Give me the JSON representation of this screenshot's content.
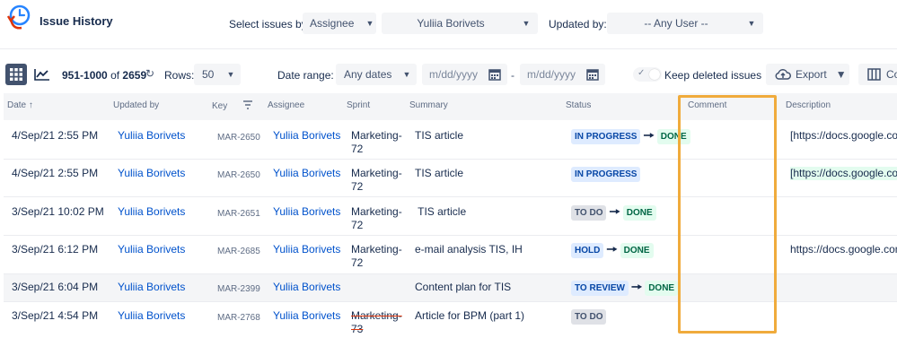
{
  "app": {
    "title": "Issue History"
  },
  "filters": {
    "select_by_label": "Select issues by:",
    "select_by_value": "Assignee",
    "assignee_value": "Yuliia Borivets",
    "updated_by_label": "Updated by:",
    "updated_by_value": "-- Any User --"
  },
  "toolbar": {
    "range_bold": "951-1000",
    "range_of": "of",
    "total": "2659",
    "rows_label": "Rows:",
    "rows_value": "50",
    "date_range_label": "Date range:",
    "date_range_value": "Any dates",
    "date_from_placeholder": "m/dd/yyyy",
    "date_to_placeholder": "m/dd/yyyy",
    "date_sep": "-",
    "keep_deleted_label": "Keep deleted issues",
    "export_label": "Export",
    "columns_label": "Co"
  },
  "columns": [
    "Date",
    "Updated by",
    "Key",
    "Assignee",
    "Sprint",
    "Summary",
    "Status",
    "Comment",
    "Description"
  ],
  "rows": [
    {
      "date": "4/Sep/21 2:55 PM",
      "updated_by": "Yuliia Borivets",
      "key": "MAR-2650",
      "assignee": "Yuliia Borivets",
      "sprint1": "Marketing-",
      "sprint2": "72",
      "summary": "TIS article",
      "status_from": "IN PROGRESS",
      "status_to": "DONE",
      "description": "[https://docs.google.com"
    },
    {
      "date": "4/Sep/21 2:55 PM",
      "updated_by": "Yuliia Borivets",
      "key": "MAR-2650",
      "assignee": "Yuliia Borivets",
      "sprint1": "Marketing-",
      "sprint2": "72",
      "summary": "TIS article",
      "status_from": "IN PROGRESS",
      "status_to": "",
      "description": "[https://docs.google.com"
    },
    {
      "date": "3/Sep/21 10:02 PM",
      "updated_by": "Yuliia Borivets",
      "key": "MAR-2651",
      "assignee": "Yuliia Borivets",
      "sprint1": "Marketing-",
      "sprint2": "72",
      "summary": " TIS article",
      "status_from": "TO DO",
      "status_to": "DONE",
      "description": ""
    },
    {
      "date": "3/Sep/21 6:12 PM",
      "updated_by": "Yuliia Borivets",
      "key": "MAR-2685",
      "assignee": "Yuliia Borivets",
      "sprint1": "Marketing-",
      "sprint2": "72",
      "summary": "e-mail analysis TIS, IH",
      "status_from": "HOLD",
      "status_to": "DONE",
      "description": "https://docs.google.com"
    },
    {
      "date": "3/Sep/21 6:04 PM",
      "updated_by": "Yuliia Borivets",
      "key": "MAR-2399",
      "assignee": "Yuliia Borivets",
      "sprint1": "",
      "sprint2": "",
      "summary": "Content plan for TIS",
      "status_from": "TO REVIEW",
      "status_to": "DONE",
      "description": ""
    },
    {
      "date": "3/Sep/21 4:54 PM",
      "updated_by": "Yuliia Borivets",
      "key": "MAR-2768",
      "assignee": "Yuliia Borivets",
      "sprint1": "Marketing-",
      "sprint2": "73",
      "summary": "Article for BPM (part 1)",
      "status_from": "TO DO",
      "status_to": "",
      "description": ""
    }
  ],
  "colors": {
    "link": "#0052cc",
    "highlight": "#f0ab3c",
    "done": "#006644",
    "in_progress": "#0747a6"
  }
}
